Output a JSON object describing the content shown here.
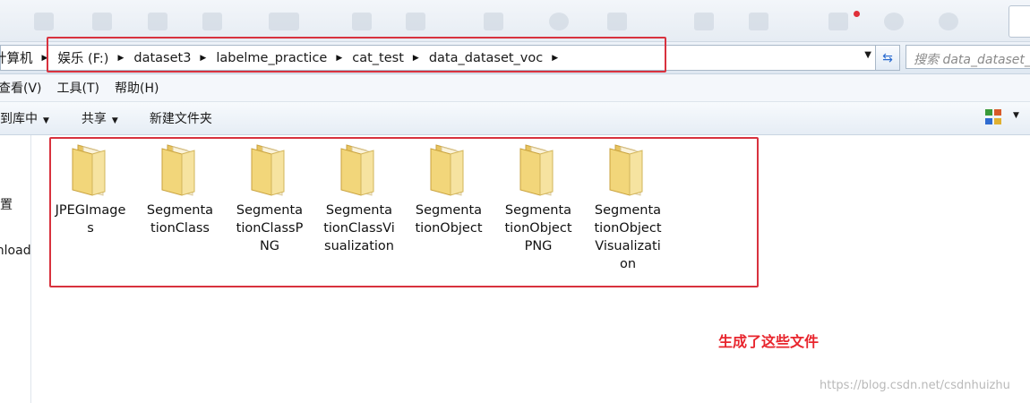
{
  "address": {
    "crumbs": [
      "计算机",
      "娱乐 (F:)",
      "dataset3",
      "labelme_practice",
      "cat_test",
      "data_dataset_voc"
    ],
    "search_placeholder": "搜索 data_dataset_voc"
  },
  "menu": {
    "items": [
      "查看(V)",
      "工具(T)",
      "帮助(H)"
    ]
  },
  "toolbar": {
    "include_library": "包含到库中",
    "share": "共享",
    "new_folder": "新建文件夹"
  },
  "nav": {
    "items": [
      "最近访问的位置",
      "Downloads"
    ]
  },
  "folders": [
    {
      "name": "JPEGImages",
      "lines": [
        "JPEGImage",
        "s"
      ]
    },
    {
      "name": "SegmentationClass",
      "lines": [
        "Segmenta",
        "tionClass"
      ]
    },
    {
      "name": "SegmentationClassPNG",
      "lines": [
        "Segmenta",
        "tionClassP",
        "NG"
      ]
    },
    {
      "name": "SegmentationClassVisualization",
      "lines": [
        "Segmenta",
        "tionClassVi",
        "sualization"
      ]
    },
    {
      "name": "SegmentationObject",
      "lines": [
        "Segmenta",
        "tionObject"
      ]
    },
    {
      "name": "SegmentationObjectPNG",
      "lines": [
        "Segmenta",
        "tionObject",
        "PNG"
      ]
    },
    {
      "name": "SegmentationObjectVisualization",
      "lines": [
        "Segmenta",
        "tionObject",
        "Visualizati",
        "on"
      ]
    }
  ],
  "annotation": "生成了这些文件",
  "watermark": "https://blog.csdn.net/csdnhuizhu",
  "colors": {
    "highlight_box": "#d8323e",
    "annotation_text": "#e8252d",
    "folder_body": "#f2d67a"
  },
  "icons": [
    "search-icon",
    "refresh-icon",
    "folder-icon",
    "view-options-icon",
    "chevron-right-icon",
    "chevron-down-icon"
  ]
}
